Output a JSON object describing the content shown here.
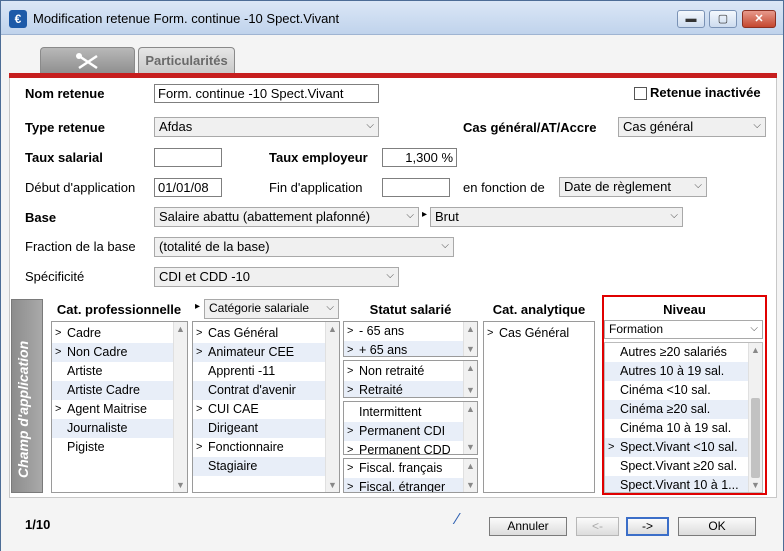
{
  "window": {
    "title": "Modification retenue Form. continue -10 Spect.Vivant",
    "icon": "app-euro-icon"
  },
  "tabs": [
    {
      "label": "",
      "icon": "tools-icon"
    },
    {
      "label": "Particularités"
    }
  ],
  "colors": {
    "accent": "#c61e1e",
    "highlight": "#e00000",
    "selected_row": "#e8eef8"
  },
  "form": {
    "nom_retenue": {
      "label": "Nom retenue",
      "value": "Form. continue -10 Spect.Vivant"
    },
    "retenue_inactivee": {
      "label": "Retenue inactivée",
      "checked": false
    },
    "type_retenue": {
      "label": "Type retenue",
      "value": "Afdas"
    },
    "cas_general": {
      "label": "Cas général/AT/Accre",
      "value": "Cas général"
    },
    "taux_salarial": {
      "label": "Taux salarial",
      "value": ""
    },
    "taux_employeur": {
      "label": "Taux employeur",
      "value": "1,300 %"
    },
    "debut_application": {
      "label": "Début d'application",
      "value": "01/01/08"
    },
    "fin_application": {
      "label": "Fin d'application",
      "value": ""
    },
    "en_fonction_de": {
      "label": "en fonction de",
      "value": "Date de règlement"
    },
    "base": {
      "label": "Base",
      "value": "Salaire abattu (abattement plafonné)",
      "value2": "Brut"
    },
    "fraction_base": {
      "label": "Fraction de la base",
      "value": "(totalité de la base)"
    },
    "specificite": {
      "label": "Spécificité",
      "value": "CDI et CDD -10"
    }
  },
  "champ": {
    "side_label": "Champ d'application",
    "cat_pro": {
      "header": "Cat. professionnelle",
      "items": [
        {
          "mark": ">",
          "label": "Cadre"
        },
        {
          "mark": ">",
          "label": "Non Cadre"
        },
        {
          "mark": "",
          "label": "Artiste"
        },
        {
          "mark": "",
          "label": "Artiste Cadre"
        },
        {
          "mark": ">",
          "label": "Agent Maitrise"
        },
        {
          "mark": "",
          "label": "Journaliste"
        },
        {
          "mark": "",
          "label": "Pigiste"
        }
      ]
    },
    "cat_sal": {
      "header": "Catégorie salariale",
      "items": [
        {
          "mark": ">",
          "label": "Cas Général"
        },
        {
          "mark": ">",
          "label": "Animateur CEE"
        },
        {
          "mark": "",
          "label": "Apprenti -11"
        },
        {
          "mark": "",
          "label": "Contrat d'avenir"
        },
        {
          "mark": ">",
          "label": "CUI CAE"
        },
        {
          "mark": "",
          "label": "Dirigeant"
        },
        {
          "mark": ">",
          "label": "Fonctionnaire"
        },
        {
          "mark": "",
          "label": "Stagiaire"
        }
      ]
    },
    "statut": {
      "header": "Statut salarié",
      "g1": [
        {
          "mark": ">",
          "label": "- 65 ans"
        },
        {
          "mark": ">",
          "label": "+ 65 ans"
        }
      ],
      "g2": [
        {
          "mark": ">",
          "label": "Non retraité"
        },
        {
          "mark": ">",
          "label": "Retraité"
        }
      ],
      "g3": [
        {
          "mark": "",
          "label": "Intermittent"
        },
        {
          "mark": ">",
          "label": "Permanent CDI"
        },
        {
          "mark": ">",
          "label": "Permanent CDD"
        }
      ],
      "g4": [
        {
          "mark": ">",
          "label": "Fiscal. français"
        },
        {
          "mark": ">",
          "label": "Fiscal. étranger"
        }
      ]
    },
    "cat_ana": {
      "header": "Cat. analytique",
      "items": [
        {
          "mark": ">",
          "label": "Cas Général"
        }
      ]
    },
    "niveau": {
      "header": "Niveau",
      "select": "Formation",
      "items": [
        {
          "mark": "",
          "label": "Autres ≥20 salariés"
        },
        {
          "mark": "",
          "label": "Autres 10 à 19 sal."
        },
        {
          "mark": "",
          "label": "Cinéma <10 sal."
        },
        {
          "mark": "",
          "label": "Cinéma ≥20 sal."
        },
        {
          "mark": "",
          "label": "Cinéma 10 à 19 sal."
        },
        {
          "mark": ">",
          "label": "Spect.Vivant <10 sal."
        },
        {
          "mark": "",
          "label": "Spect.Vivant ≥20 sal."
        },
        {
          "mark": "",
          "label": "Spect.Vivant 10 à 1..."
        }
      ]
    }
  },
  "footer": {
    "page": "1/10",
    "annuler": "Annuler",
    "prev": "<-",
    "next": "->",
    "ok": "OK"
  }
}
